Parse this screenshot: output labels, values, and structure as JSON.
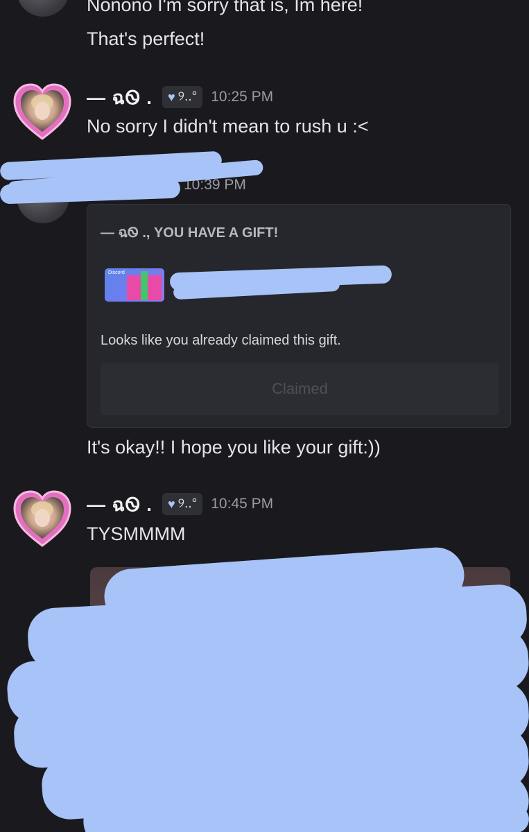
{
  "messages": {
    "top_line_1": "Nonono I'm sorry that is, Im here!",
    "top_line_2": "That's perfect!",
    "msg1": {
      "username": "— ฉᏫ .",
      "tag": "୨..°",
      "time": "10:25 PM",
      "text": "No sorry I didn't mean to rush u :<"
    },
    "msg2": {
      "time": "10:39 PM",
      "gift": {
        "heading": "— ฉᏫ ., YOU HAVE A GIFT!",
        "thumb_label": "Discord",
        "note": "Looks like you already claimed this gift.",
        "button_label": "Claimed"
      },
      "text": "It's okay!! I hope you like your gift:))"
    },
    "msg3": {
      "username": "— ฉᏫ .",
      "tag": "୨..°",
      "time": "10:45 PM",
      "text": "TYSMMMM"
    }
  },
  "colors": {
    "background": "#1a1a1e",
    "scribble": "#a7c3f7",
    "avatar_frame": "#e26fc0"
  },
  "icons": {
    "avatar_frame": "heart-frame-icon",
    "tag_heart": "heart-icon",
    "gift": "gift-icon"
  }
}
